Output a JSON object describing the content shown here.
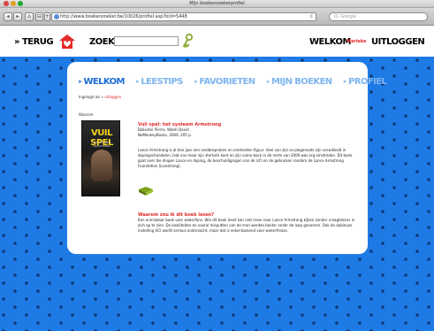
{
  "browser": {
    "window_title": "Mijn boekenzoekerprofiel",
    "url": "http://www.boekenzoeker.be/10026/profiel.asp?bid=5448",
    "search_placeholder": "Q- Google",
    "back_glyph": "◂",
    "forward_glyph": "▸",
    "home_glyph": "⌂",
    "bookmark_glyph": "⊟",
    "add_glyph": "+",
    "reload_glyph": "c"
  },
  "header": {
    "back_label": "» TERUG",
    "search_label": "ZOEK",
    "welcome_label": "WELKOM",
    "user_name": "Marieke",
    "logout_label": "UITLOGGEN"
  },
  "tabs": [
    {
      "label": "WELKOM",
      "active": true
    },
    {
      "label": "LEESTIPS",
      "active": false
    },
    {
      "label": "FAVORIETEN",
      "active": false
    },
    {
      "label": "MIJN BOEKEN",
      "active": false
    },
    {
      "label": "PROFIEL",
      "active": false
    }
  ],
  "tab_arrow": "➤",
  "breadcrumb": {
    "first": "Ingelogd als",
    "separator": " » ",
    "link": "uitloggen"
  },
  "waarom_label": "Waarom",
  "book": {
    "cover_title": "VUIL SPEL",
    "cover_subtitle": "HET SYSTEEM ARMSTRONG",
    "title": "Vuil spel: het systeem Armstrong",
    "authors": "Ballester Pierre, Walsh David",
    "publisher": "NoMonkeyBooks, 2009, 205 p.",
    "description": "Lance Armstrong is al tien jaar een veelbesproken en omstreden figuur. Veel van zijn se-plegereads zijn verwikkeld in dopingschandalen, laat ons maar zijn sterkste kant en zijn come-back in de rente van 2009 was erg omstreden. Dit boek gaat over die dingen Lance en doping, de beschuldigingen van de UCI en de gebruiken rondom de Lance Armstrong Foundation (Livestrong)."
  },
  "reason": {
    "title": "Waarom zou ik dit boek lezen?",
    "text": "Een onmisbaar boek voor wielerfans. Wie dit boek leest kan niet meer naar Lance Armstrong kijken zonder vraagtekens in zich op te zien. De kwaliteiten en vooral misputten van de man worden beider onder de loep genomen. Ook de dubieuze instelling UCI wordt serieus onderzocht, maar dat is enkel boeiend voor wielerfreaks."
  },
  "colors": {
    "page_blue": "#1e7be5",
    "dot_blue": "#0f3c7a",
    "tab_active": "#1a6cd8",
    "tab_inactive": "#7fb5ee",
    "accent_red": "#e32a2a"
  },
  "icons": {
    "logo": "house-heart-logo-icon",
    "key": "key-icon",
    "book": "green-book-icon"
  }
}
